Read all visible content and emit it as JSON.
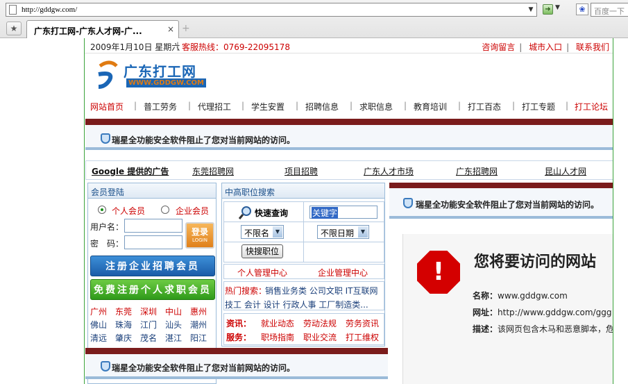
{
  "browser": {
    "url": "http://gddgw.com/",
    "search_placeholder": "百度一下",
    "tab_title": "广东打工网-广东人才网-广...",
    "tab_close": "×",
    "new_tab": "+"
  },
  "topbar": {
    "date": "2009年1月10日 星期六",
    "hotline": "客服热线：0769-22095178",
    "links": [
      "咨询留言",
      "城市入口",
      "联系我们"
    ]
  },
  "logo": {
    "cn": "广东打工网",
    "en": "WWW.GDDGW.COM"
  },
  "nav": [
    "网站首页",
    "普工劳务",
    "代理招工",
    "学生安置",
    "招聘信息",
    "求职信息",
    "教育培训",
    "打工百态",
    "打工专题",
    "打工论坛"
  ],
  "blocked_message": "瑞星全功能安全软件阻止了您对当前网站的访问。",
  "ads": {
    "title": "Google 提供的广告",
    "items": [
      "东莞招聘网",
      "项目招聘",
      "广东人才市场",
      "广东招聘网",
      "昆山人才网"
    ]
  },
  "login": {
    "title": "会员登陆",
    "radio_personal": "个人会员",
    "radio_company": "企业会员",
    "username_label": "用户名：",
    "password_label": "密　码：",
    "login_button": "登录",
    "login_button_en": "LOGIN",
    "register_company": "注册企业招聘会员",
    "register_person": "免费注册个人求职会员",
    "cities": [
      [
        "广州",
        "东莞",
        "深圳",
        "中山",
        "惠州"
      ],
      [
        "佛山",
        "珠海",
        "江门",
        "汕头",
        "潮州"
      ],
      [
        "清远",
        "肇庆",
        "茂名",
        "湛江",
        "阳江"
      ]
    ]
  },
  "jobsearch": {
    "title": "中高职位搜索",
    "quick_label": "快速查询",
    "keyword": "关键字",
    "select_name": "不限名",
    "select_date": "不限日期",
    "search_button": "快搜职位",
    "personal_center": "个人管理中心",
    "company_center": "企业管理中心",
    "hot_label": "热门搜索：",
    "hot_line1": "销售业务类 公司文职 IT互联网",
    "hot_line2": "技工 会计 设计 行政人事 工厂制造类...",
    "info_label": "资讯：",
    "info_items": [
      "就业动态",
      "劳动法规",
      "劳务资讯"
    ],
    "service_label": "服务：",
    "service_items": [
      "职场指南",
      "职业交流",
      "打工维权"
    ]
  },
  "warning": {
    "title": "您将要访问的网站",
    "name_label": "名称：",
    "name_value": "www.gddgw.com",
    "url_label": "网址：",
    "url_value": "http://www.gddgw.com/ggg",
    "desc_label": "描述：",
    "desc_value": "该网页包含木马和恶意脚本，危"
  },
  "colors": {
    "accent_red": "#cc0000",
    "brand_blue": "#1a66b6",
    "bar_dark_red": "#7a1c1c",
    "border_green": "#3aa33a"
  }
}
